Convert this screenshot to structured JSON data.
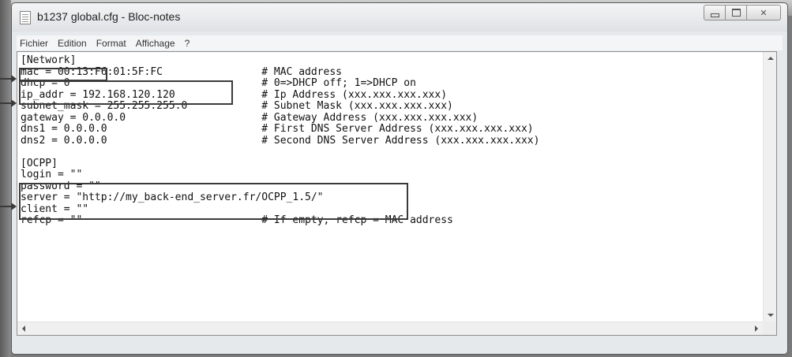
{
  "window": {
    "title": "b1237 global.cfg - Bloc-notes"
  },
  "menu": [
    "Fichier",
    "Edition",
    "Format",
    "Affichage",
    "?"
  ],
  "file_content": "[Network]\nmac = 00:13:F6:01:5F:FC                # MAC address\ndhcp = 0                               # 0=>DHCP off; 1=>DHCP on\nip_addr = 192.168.120.120              # Ip Address (xxx.xxx.xxx.xxx)\nsubnet_mask = 255.255.255.0            # Subnet Mask (xxx.xxx.xxx.xxx)\ngateway = 0.0.0.0                      # Gateway Address (xxx.xxx.xxx.xxx)\ndns1 = 0.0.0.0                         # First DNS Server Address (xxx.xxx.xxx.xxx)\ndns2 = 0.0.0.0                         # Second DNS Server Address (xxx.xxx.xxx.xxx)\n\n[OCPP]\nlogin = \"\"\npassword = \"\"\nserver = \"http://my_back-end_server.fr/OCPP_1.5/\"\nclient = \"\"\nrefcp = \"\"                             # If empty, refcp = MAC address"
}
